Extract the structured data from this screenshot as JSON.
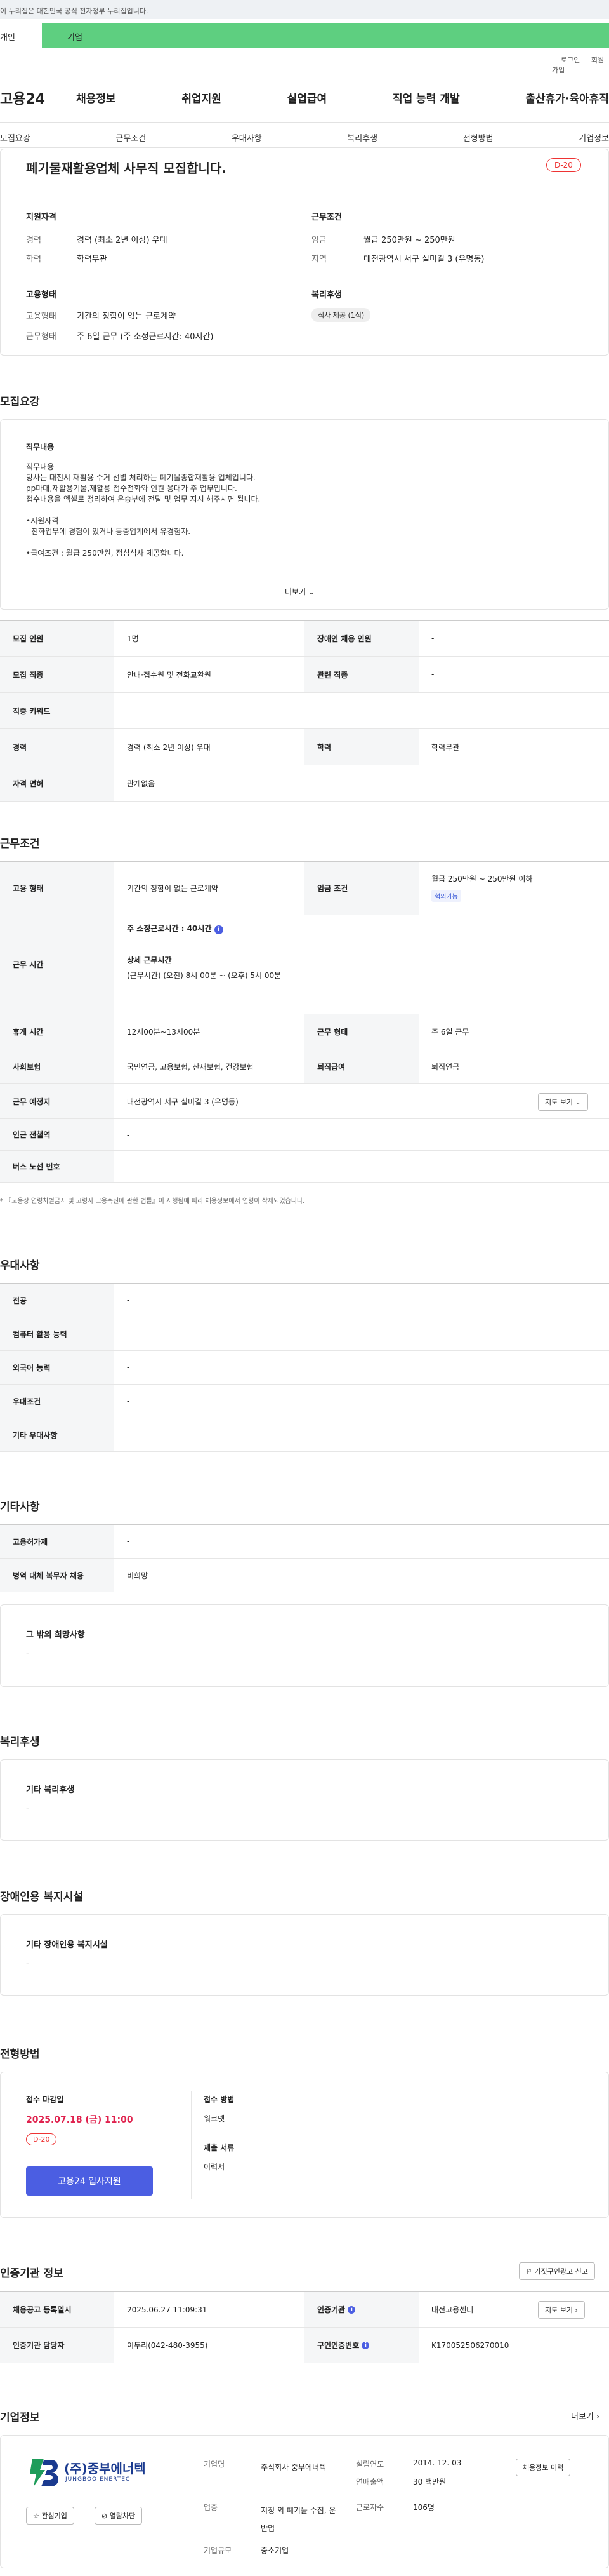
{
  "topbar": {
    "text": "이 누리집은 대한민국 공식 전자정부 누리집입니다."
  },
  "user_tabs": {
    "personal": "개인",
    "company": "기업"
  },
  "util": {
    "login": "로그인",
    "join": "회원가입"
  },
  "header": {
    "logo": "고용24",
    "menu": [
      "채용정보",
      "취업지원",
      "실업급여",
      "직업 능력 개발",
      "출산휴가·육아휴직"
    ]
  },
  "subnav": [
    "모집요강",
    "근무조건",
    "우대사항",
    "복리후생",
    "전형방법",
    "기업정보"
  ],
  "summary": {
    "title": "폐기물재활용업체 사무직 모집합니다.",
    "dday": "D-20",
    "qual_title": "지원자격",
    "career_label": "경력",
    "career_value": "경력 (최소 2년 이상) 우대",
    "edu_label": "학력",
    "edu_value": "학력무관",
    "cond_title": "근무조건",
    "wage_label": "임금",
    "wage_value": "월급 250만원 ~ 250만원",
    "area_label": "지역",
    "area_value": "대전광역시 서구 실미길 3 (우명동)",
    "emp_title": "고용형태",
    "emptype_label": "고용형태",
    "emptype_value": "기간의 정함이 없는 근로계약",
    "worktype_label": "근무형태",
    "worktype_value": "주 6일 근무 (주 소정근로시간: 40시간)",
    "welfare_title": "복리후생",
    "welfare_pill": "식사 제공 (1식)"
  },
  "recruit": {
    "section": "모집요강",
    "duty_title": "직무내용",
    "lines": [
      "직무내용",
      "당사는 대전시 재활용 수거 선별 처리하는 폐기물종합재활용 업체입니다.",
      "pp마대,재활용기물,재활용 접수전화와 인원 응대가 주 업무입니다.",
      "접수내용을 엑셀로 정리하여 운송부에 전달 및 업무 지시 해주시면 됩니다.",
      "",
      "•지원자격",
      " - 전화업무에 경험이 있거나 동종업계에서 유경험자.",
      "",
      "•급여조건 : 월급 250만원, 점심식사 제공합니다."
    ],
    "more": "더보기",
    "table": [
      [
        "모집 인원",
        "1명",
        "장애인 채용 인원",
        "-"
      ],
      [
        "모집 직종",
        "안내·접수원 및 전화교환원",
        "관련 직종",
        "-"
      ],
      [
        "직종 키워드",
        "-",
        "",
        ""
      ],
      [
        "경력",
        "경력 (최소 2년 이상) 우대",
        "학력",
        "학력무관"
      ],
      [
        "자격 면허",
        "관계없음",
        "",
        ""
      ]
    ]
  },
  "work": {
    "section": "근무조건",
    "emp_label": "고용 형태",
    "emp_value": "기간의 정함이 없는 근로계약",
    "wage_label": "임금 조건",
    "wage_value": "월급 250만원 ~ 250만원 이하",
    "wage_tag": "협의가능",
    "hours_label": "근무 시간",
    "hours_week": "주 소정근로시간 : 40시간",
    "hours_detail_title": "상세 근무시간",
    "hours_detail": "(근무시간) (오전) 8시 00분 ~ (오후) 5시 00분",
    "rest_label": "휴게 시간",
    "rest_value": "12시00분~13시00분",
    "form_label": "근무 형태",
    "form_value": "주 6일 근무",
    "ins_label": "사회보험",
    "ins_value": "국민연금, 고용보험, 산재보험, 건강보험",
    "sev_label": "퇴직급여",
    "sev_value": "퇴직연금",
    "place_label": "근무 예정지",
    "place_value": "대전광역시 서구 실미길 3 (우명동)",
    "map_btn": "지도 보기",
    "subway_label": "인근 전철역",
    "subway_value": "-",
    "bus_label": "버스 노선 번호",
    "bus_value": "-",
    "notice": "* 『고용상 연령차별금지 및 고령자 고용촉진에 관한 법률』이 시행됨에 따라 채용정보에서 연령이 삭제되었습니다."
  },
  "pref": {
    "section": "우대사항",
    "rows": [
      [
        "전공",
        "-"
      ],
      [
        "컴퓨터 활용 능력",
        "-"
      ],
      [
        "외국어 능력",
        "-"
      ],
      [
        "우대조건",
        "-"
      ],
      [
        "기타 우대사항",
        "-"
      ]
    ]
  },
  "other": {
    "section": "기타사항",
    "rows": [
      [
        "고용허가제",
        "-"
      ],
      [
        "병역 대체 복무자 채용",
        "비희망"
      ]
    ],
    "etc_title": "그 밖의 희망사항",
    "etc_value": "-"
  },
  "welfare": {
    "section": "복리후생",
    "title": "기타 복리후생",
    "value": "-"
  },
  "disab": {
    "section": "장애인용 복지시설",
    "title": "기타 장애인용 복지시설",
    "value": "-"
  },
  "apply": {
    "section": "전형방법",
    "deadline_label": "접수 마감일",
    "deadline": "2025.07.18 (금) 11:00",
    "dday": "D-20",
    "apply_btn": "고용24 입사지원",
    "method_label": "접수 방법",
    "method": "워크넷",
    "docs_label": "제출 서류",
    "docs": "이력서"
  },
  "cert": {
    "section": "인증기관 정보",
    "report_btn": "거짓구인광고 신고",
    "reg_label": "채용공고 등록일시",
    "reg_value": "2025.06.27 11:09:31",
    "org_label": "인증기관",
    "org_value": "대전고용센터",
    "map_btn": "지도 보기",
    "mgr_label": "인증기관 담당자",
    "mgr_value": "이두리(042-480-3955)",
    "no_label": "구인인증번호",
    "no_value": "K170052506270010"
  },
  "company": {
    "section": "기업정보",
    "more": "더보기",
    "name": "(주)중부에너텍",
    "name_en": "JUNGBOO ENERTEC",
    "fav_btn": "관심기업",
    "block_btn": "열람차단",
    "name_label": "기업명",
    "name_value": "주식회사 중부에너텍",
    "est_label": "설립연도",
    "est_value": "2014. 12. 03",
    "sales_label": "연매출액",
    "sales_value": "30 백만원",
    "ind_label": "업종",
    "ind_value": "지정 외 폐기물 수집, 운반업",
    "emp_label": "근로자수",
    "emp_value": "106명",
    "size_label": "기업규모",
    "size_value": "중소기업",
    "jobs_btn": "채용정보 이력"
  },
  "colors": {
    "accent": "#4b5ee2",
    "brand_green": "#5ecf80",
    "dday": "#e0224e"
  }
}
